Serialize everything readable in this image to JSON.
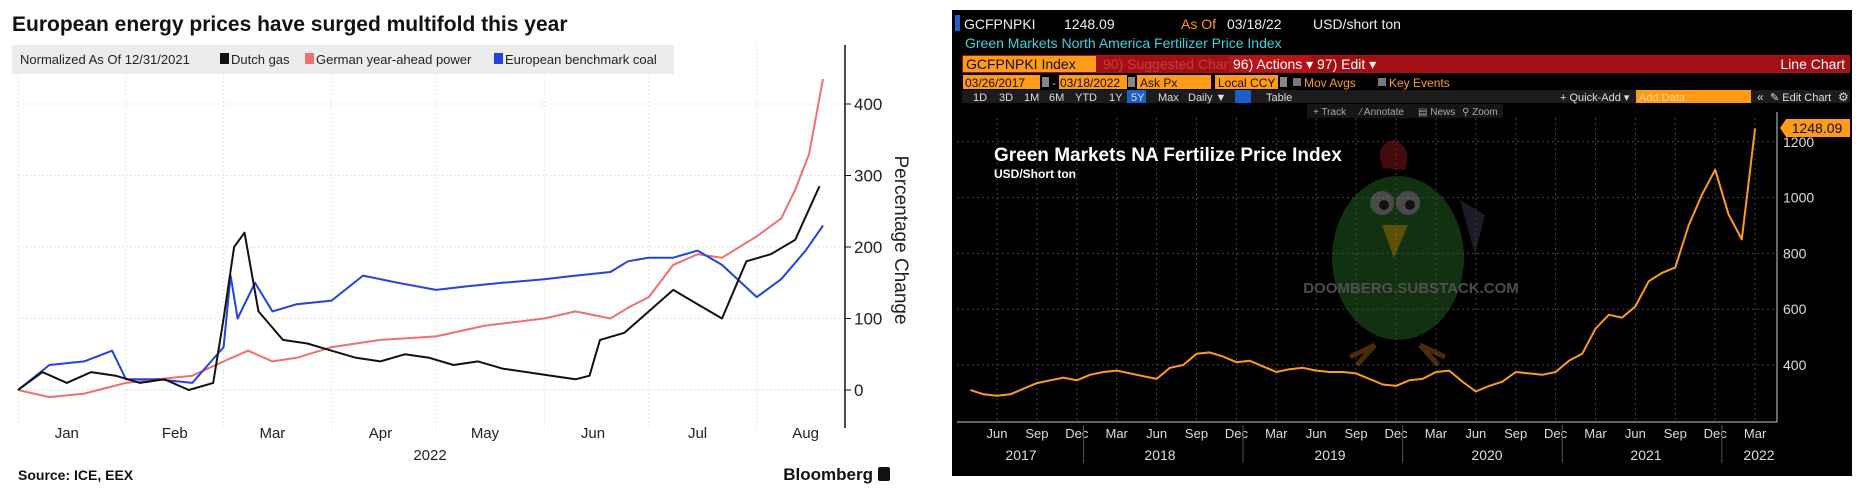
{
  "chart_data": [
    {
      "type": "line",
      "title": "European energy prices have surged multifold this year",
      "legend_title": "Normalized As Of 12/31/2021",
      "legend_placement": "top-left",
      "ylabel": "Percentage Change",
      "xlabel": "2022",
      "ylim": [
        -53,
        482
      ],
      "grid": true,
      "yticks": [
        0,
        100,
        200,
        300,
        400
      ],
      "xticks": [
        "Jan",
        "Feb",
        "Mar",
        "Apr",
        "May",
        "Jun",
        "Jul",
        "Aug"
      ],
      "x_unit": "day of year 2022 (0 = Jan 1)",
      "series": [
        {
          "name": "Dutch gas",
          "color": "#111111",
          "x": [
            0,
            7,
            14,
            21,
            28,
            35,
            42,
            49,
            56,
            59,
            62,
            65,
            69,
            76,
            83,
            90,
            97,
            104,
            111,
            118,
            125,
            132,
            139,
            146,
            153,
            160,
            164,
            167,
            174,
            181,
            188,
            195,
            202,
            209,
            216,
            223,
            230
          ],
          "values": [
            0,
            25,
            10,
            25,
            20,
            10,
            15,
            0,
            10,
            100,
            200,
            220,
            110,
            70,
            65,
            55,
            45,
            40,
            50,
            45,
            35,
            40,
            30,
            25,
            20,
            15,
            20,
            70,
            80,
            110,
            140,
            120,
            100,
            180,
            190,
            210,
            285
          ]
        },
        {
          "name": "German year-ahead power",
          "color": "#f07070",
          "x": [
            0,
            9,
            19,
            31,
            40,
            50,
            59,
            66,
            73,
            80,
            90,
            104,
            120,
            134,
            151,
            160,
            170,
            175,
            181,
            188,
            195,
            202,
            212,
            219,
            223,
            227,
            231
          ],
          "values": [
            0,
            -10,
            -5,
            10,
            15,
            20,
            40,
            55,
            40,
            45,
            60,
            70,
            75,
            90,
            100,
            110,
            100,
            115,
            130,
            175,
            190,
            185,
            215,
            240,
            280,
            330,
            435
          ]
        },
        {
          "name": "European benchmark coal",
          "color": "#2244dd",
          "x": [
            0,
            9,
            19,
            27,
            31,
            40,
            50,
            59,
            61,
            63,
            68,
            73,
            80,
            90,
            99,
            109,
            120,
            129,
            139,
            151,
            160,
            170,
            175,
            181,
            188,
            195,
            202,
            212,
            219,
            226,
            231
          ],
          "values": [
            0,
            35,
            40,
            55,
            15,
            15,
            10,
            60,
            160,
            100,
            150,
            110,
            120,
            125,
            160,
            150,
            140,
            145,
            150,
            155,
            160,
            165,
            180,
            185,
            185,
            195,
            175,
            130,
            155,
            195,
            230
          ]
        }
      ],
      "source": "Source: ICE, EEX",
      "brand": "Bloomberg"
    },
    {
      "type": "line",
      "title": "Green Markets NA Fertilize Price Index",
      "subtitle": "USD/Short ton",
      "ylim": [
        200,
        1339
      ],
      "grid": true,
      "yticks": [
        400,
        600,
        800,
        1000,
        1200
      ],
      "x_unit": "months since Jan 2017",
      "xtick_months": [
        "Jun",
        "Sep",
        "Dec",
        "Mar",
        "Jun",
        "Sep",
        "Dec",
        "Mar",
        "Jun",
        "Sep",
        "Dec",
        "Mar",
        "Jun",
        "Sep",
        "Dec",
        "Mar",
        "Jun",
        "Sep",
        "Dec",
        "Mar"
      ],
      "xtick_years": [
        "2017",
        "2018",
        "2019",
        "2020",
        "2021",
        "2022"
      ],
      "series": [
        {
          "name": "GCFPNPKI",
          "color": "#ff9a1a",
          "x_start_month": 3,
          "values": [
            310,
            295,
            290,
            295,
            315,
            335,
            345,
            355,
            345,
            365,
            375,
            380,
            370,
            360,
            350,
            390,
            400,
            440,
            445,
            430,
            410,
            415,
            395,
            375,
            385,
            390,
            380,
            375,
            375,
            370,
            350,
            330,
            325,
            345,
            350,
            375,
            380,
            340,
            305,
            325,
            340,
            375,
            370,
            365,
            375,
            415,
            440,
            530,
            580,
            570,
            610,
            700,
            730,
            750,
            900,
            1010,
            1100,
            940,
            850,
            1248.09
          ]
        }
      ],
      "last_value_label": "1248.09",
      "watermark": "DOOMBERG.SUBSTACK.COM"
    }
  ],
  "terminal": {
    "ticker": "GCFPNPKI",
    "price": "1248.09",
    "as_of_label": "As Of",
    "as_of_date": "03/18/22",
    "unit": "USD/short ton",
    "description": "Green Markets North America Fertilizer Price Index",
    "security": "GCFPNPKI Index",
    "suggested": "90) Suggested Charts",
    "actions": "96) Actions ▾",
    "edit": "97) Edit ▾",
    "chart_type": "Line Chart",
    "start_date": "03/26/2017",
    "dash": "-",
    "end_date": "03/18/2022",
    "field": "Ask Px",
    "currency": "Local CCY",
    "mov_avgs": "Mov Avgs",
    "key_events": "Key Events",
    "periods": [
      "1D",
      "3D",
      "1M",
      "6M",
      "YTD",
      "1Y",
      "5Y",
      "Max"
    ],
    "active_period": "5Y",
    "frequency": "Daily ▼",
    "table": "Table",
    "quick_add": "+ Quick-Add ▾",
    "add_data_placeholder": "Add Data",
    "collapse": "«",
    "edit_chart": "✎ Edit Chart",
    "gear": "⚙",
    "tools": [
      "+ Track",
      "⁄ Annotate",
      "▤ News",
      "⚲ Zoom"
    ],
    "colors": {
      "bg": "#000000",
      "red_bar": "#a50e13",
      "orange": "#ff9a1a",
      "cyan": "#3fd0d8",
      "blue": "#1a5fd0"
    }
  }
}
